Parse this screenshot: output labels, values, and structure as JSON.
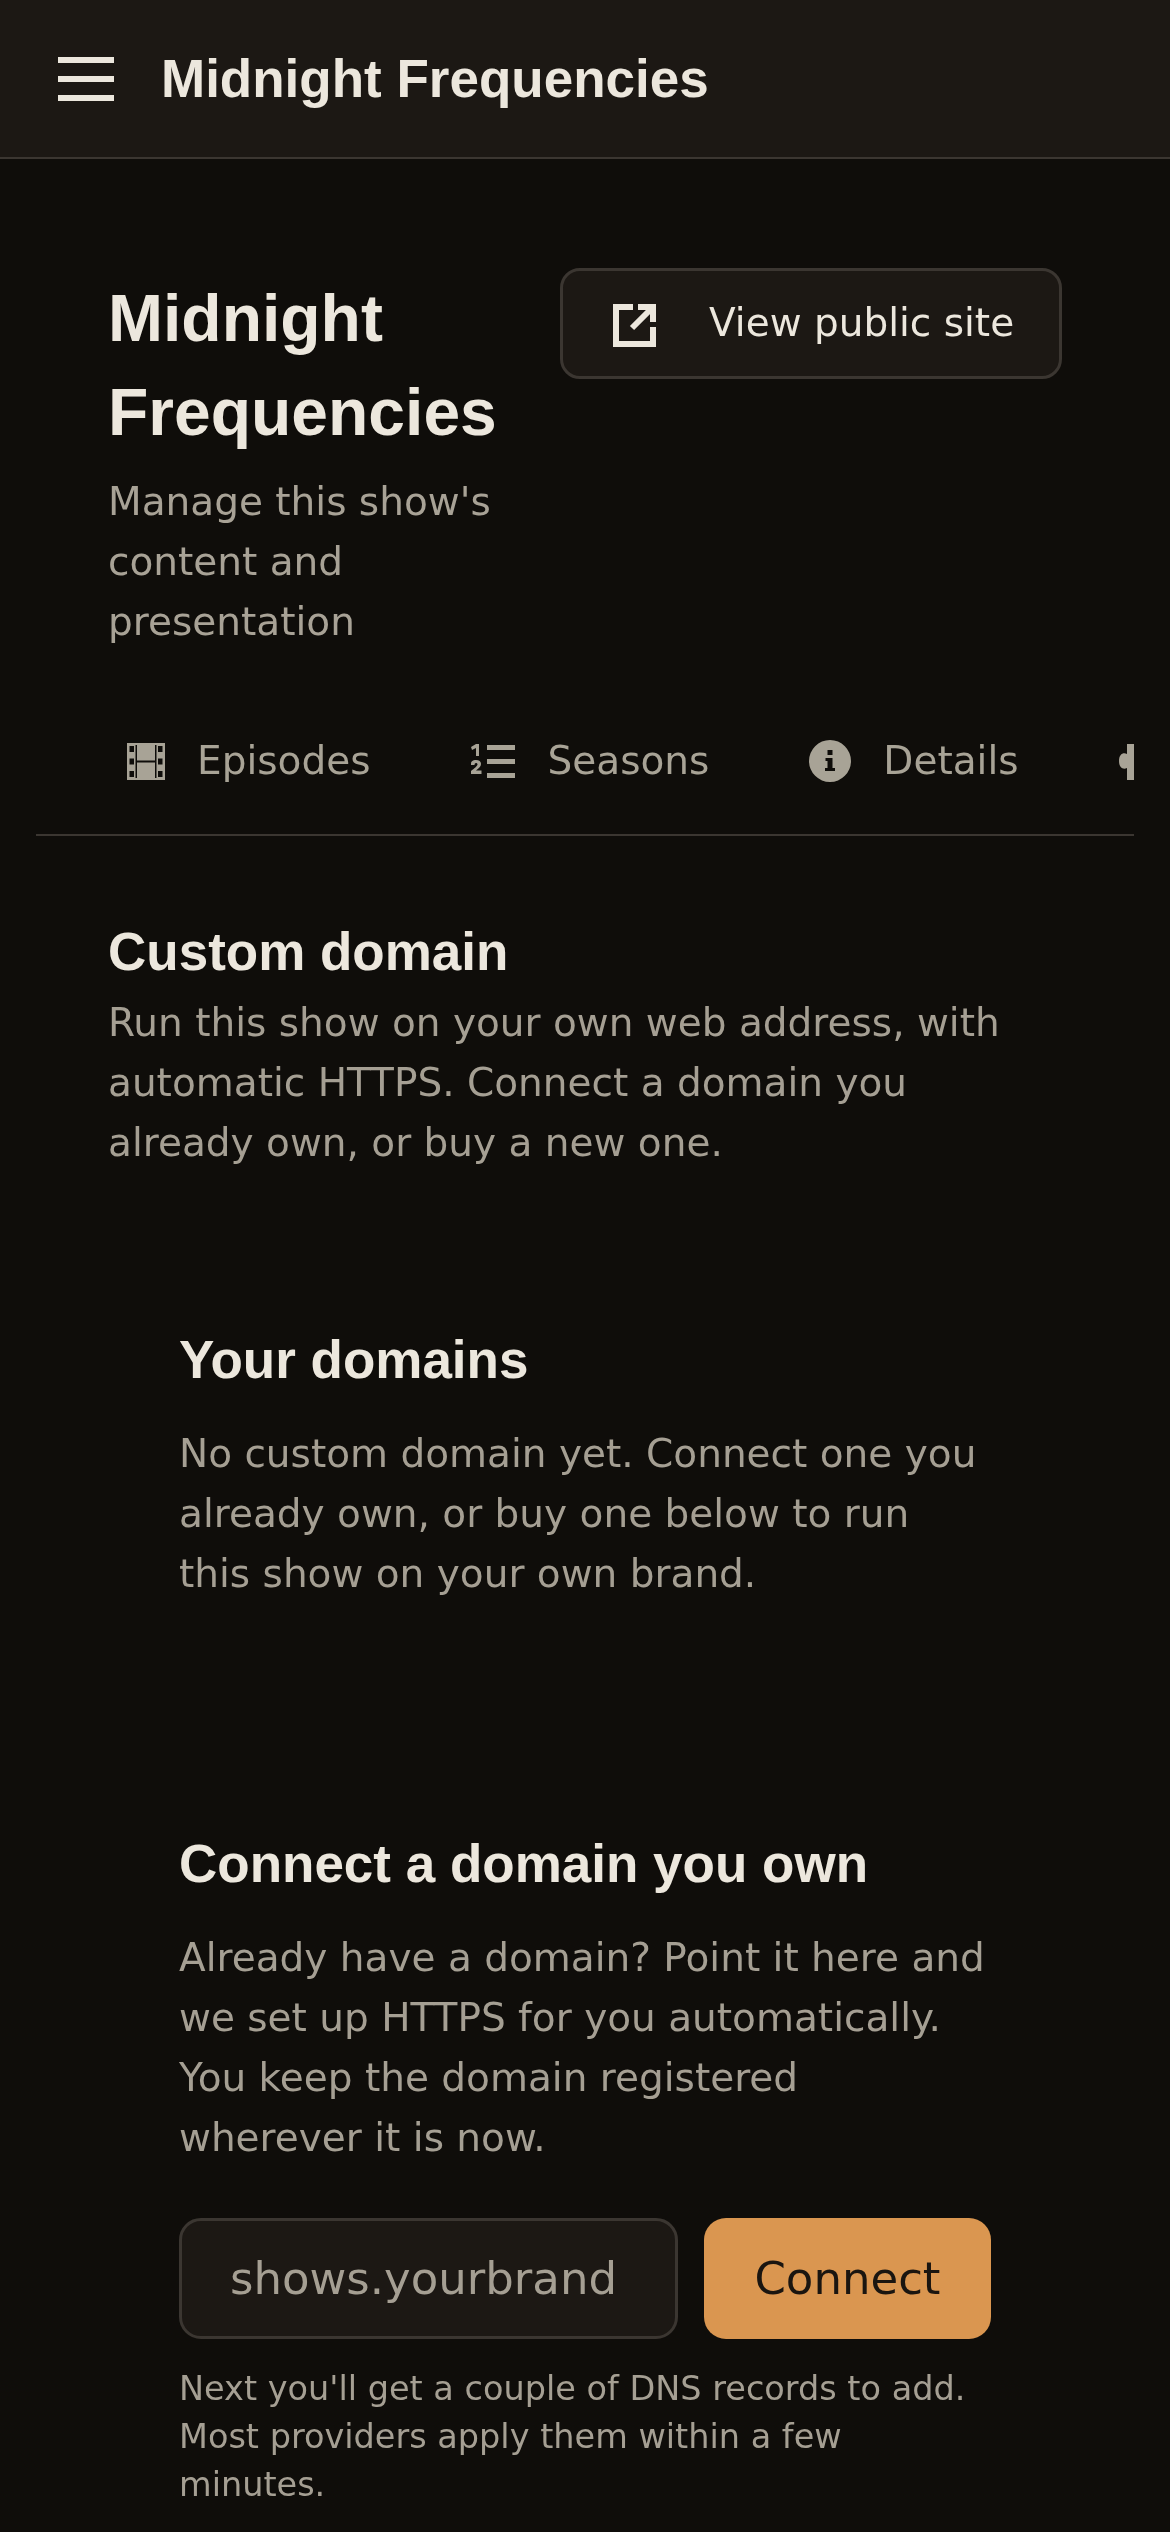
{
  "app_bar": {
    "title": "Midnight Frequencies"
  },
  "show_header": {
    "title": "Midnight Frequencies",
    "subtitle": "Manage this show's content and presentation",
    "view_site_button": "View public site"
  },
  "tabs": [
    {
      "label": "Episodes",
      "selected": false
    },
    {
      "label": "Seasons",
      "selected": false
    },
    {
      "label": "Details",
      "selected": false
    },
    {
      "selected": false
    }
  ],
  "section": {
    "title": "Custom domain",
    "description": "Run this show on your own web address, with automatic HTTPS. Connect a domain you already own, or buy a new one."
  },
  "your_domains": {
    "title": "Your domains",
    "empty_message": "No custom domain yet. Connect one you already own, or buy one below to run this show on your own brand."
  },
  "connect_domain": {
    "title": "Connect a domain you own",
    "description": "Already have a domain? Point it here and we set up HTTPS for you automatically. You keep the domain registered wherever it is now.",
    "domain_field": {
      "placeholder": "shows.yourbrand"
    },
    "connect_button": "Connect",
    "note": "Next you'll get a couple of DNS records to add. Most providers apply them within a few minutes."
  }
}
